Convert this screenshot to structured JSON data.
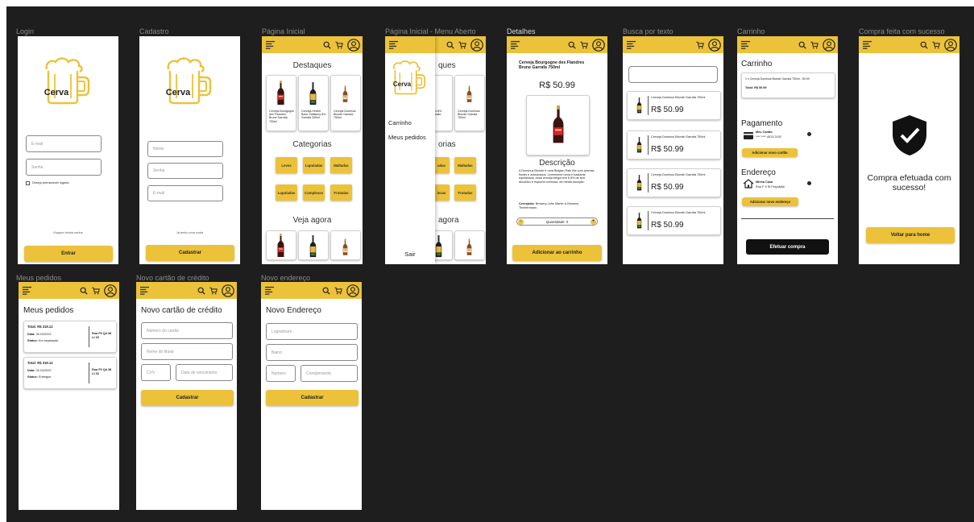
{
  "colors": {
    "canvas": "#1e1e1e",
    "accent": "#ecc23a",
    "text": "#222222",
    "frame_title": "#8a8a8a"
  },
  "frames": {
    "login": "Login",
    "cadastro": "Cadastro",
    "inicial": "Página Inicial",
    "menu": "Página Inicial - Menu Aberto",
    "detalhes": "Detalhes",
    "busca": "Busca por texto",
    "carrinho": "Carrinho",
    "sucesso": "Compra feita com sucesso",
    "pedidos": "Meus pedidos",
    "cartao": "Novo cartão de crédito",
    "endereco": "Novo endereço"
  },
  "brand": {
    "logo_text": "Cerva"
  },
  "login": {
    "email_placeholder": "E-mail",
    "password_placeholder": "Senha",
    "remember_label": "Desejo permanecer logado",
    "forgot_label": "Esqueci minha senha",
    "submit_label": "Entrar"
  },
  "cadastro": {
    "name_placeholder": "Nome",
    "password_placeholder": "Senha",
    "email_placeholder": "E-mail",
    "have_account_label": "Já tenho uma conta",
    "submit_label": "Cadastrar"
  },
  "inicial": {
    "highlights_title": "Destaques",
    "highlights": [
      {
        "name": "Cerveja Bourgogne des Flandres Brune Garrafa 750ml"
      },
      {
        "name": "Cerveja Hedelt Boku Gallistory 8% Garrafa 330ml"
      },
      {
        "name": "Cerveja Dominus Blonde Garrafa 750ml"
      }
    ],
    "categories_title": "Categorias",
    "categories": [
      "Leves",
      "Lupuladas",
      "Maltadas",
      "Lupuladas",
      "Complexas",
      "Frutadas"
    ],
    "see_now_title": "Veja agora"
  },
  "menu": {
    "items": [
      "Carrinho",
      "Meus pedidos"
    ],
    "logout_label": "Sair",
    "behind_highlights": "ques",
    "behind_categories": "orias",
    "behind_see_now": "agora",
    "behind_card1": "ttrés 8% Garrafa",
    "behind_card2": "Cerveja Dominus Blonde Garrafa 750ml",
    "behind_cat1": "adas",
    "behind_cat2": "Maltadas",
    "behind_cat3": "lexas",
    "behind_cat4": "Frutadas"
  },
  "detalhes": {
    "product_name": "Cerveja Bourgogne des Flandres Brune Garrafa 750ml",
    "price": "R$ 50.99",
    "description_title": "Descrição",
    "description": "A Dominus Blonde é uma Belgian Pale Ale com aromas florais e adocicados. Levemente turva e bastante equilibrada, essa cerveja belga tem 6,5% de teor alcoólico e espuma cremosa, de média duração.",
    "brewery_label": "Cervejaria:",
    "brewery_value": "Brewery John Martin & Brewery Timmermans",
    "quantity_label": "Quantidade: 0",
    "minus_label": "-",
    "plus_label": "+",
    "add_to_cart_label": "Adicionar ao carrinho"
  },
  "busca": {
    "search_value": "",
    "results": [
      {
        "name": "Cerveja Dominus Blonde Garrafa 750ml",
        "price": "R$ 50.99"
      },
      {
        "name": "Cerveja Dominus Blonde Garrafa 750ml",
        "price": "R$ 50.99"
      },
      {
        "name": "Cerveja Dominus Blonde Garrafa 750ml",
        "price": "R$ 50.99"
      },
      {
        "name": "Cerveja Dominus Blonde Garrafa 750ml",
        "price": "R$ 50.99"
      }
    ]
  },
  "carrinho": {
    "title": "Carrinho",
    "item_line": "1 x Cerveja Dominus Blonde Garrafa 750ml - 50.99",
    "total_line": "Total: R$ 50.99",
    "payment_title": "Pagamento",
    "card_name": "Meu Cartão",
    "card_number": "**** **** 4513 2192",
    "add_card_label": "Adicionar novo cartão",
    "address_title": "Endereço",
    "address_name": "Minha Casa",
    "address_line": "Rua F-9 St Feiçalville",
    "add_address_label": "Adicionar novo endereço",
    "checkout_label": "Efetuar compra"
  },
  "sucesso": {
    "message": "Compra efetuada com sucesso!",
    "home_label": "Voltar para home"
  },
  "pedidos": {
    "title": "Meus pedidos",
    "orders": [
      {
        "total": "Total: R$ 319.12",
        "date_label": "Data:",
        "date": "31/10/2022",
        "status_label": "Status:",
        "status": "Em separação",
        "address": "Rua F9 Qd 38 Lt 33"
      },
      {
        "total": "Total: R$ 319.12",
        "date_label": "Data:",
        "date": "01/10/2022",
        "status_label": "Status:",
        "status": "Entregue",
        "address": "Rua F9 Qd 38 Lt 33"
      }
    ]
  },
  "cartao": {
    "title": "Novo cartão de crédito",
    "number_placeholder": "Número do cartão",
    "holder_placeholder": "Nome do titular",
    "cvv_placeholder": "CVV",
    "expiry_placeholder": "Data de vencimento",
    "submit_label": "Cadastrar"
  },
  "endereco": {
    "title": "Novo Endereço",
    "street_placeholder": "Logradouro",
    "district_placeholder": "Bairro",
    "number_placeholder": "Número",
    "complement_placeholder": "Complemento",
    "submit_label": "Cadastrar"
  }
}
